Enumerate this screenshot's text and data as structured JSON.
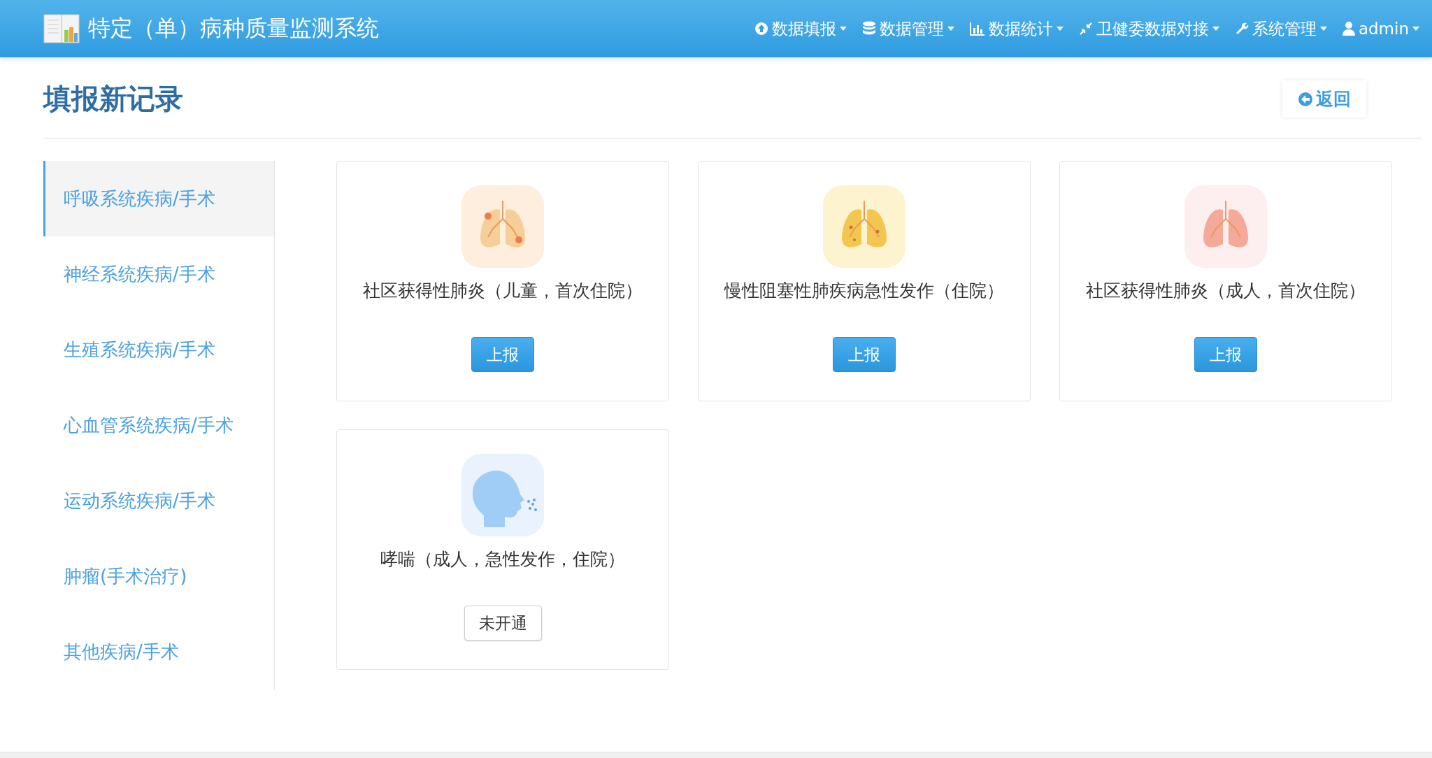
{
  "header": {
    "title": "特定（单）病种质量监测系统",
    "nav": [
      {
        "label": "数据填报",
        "kind": "upload"
      },
      {
        "label": "数据管理",
        "kind": "database"
      },
      {
        "label": "数据统计",
        "kind": "chart"
      },
      {
        "label": "卫健委数据对接",
        "kind": "compress"
      },
      {
        "label": "系统管理",
        "kind": "wrench"
      },
      {
        "label": "admin",
        "kind": "user"
      }
    ]
  },
  "page": {
    "title": "填报新记录",
    "back_button": "返回"
  },
  "sidebar": {
    "items": [
      {
        "label": "呼吸系统疾病/手术",
        "selected": true
      },
      {
        "label": "神经系统疾病/手术",
        "selected": false
      },
      {
        "label": "生殖系统疾病/手术",
        "selected": false
      },
      {
        "label": "心血管系统疾病/手术",
        "selected": false
      },
      {
        "label": "运动系统疾病/手术",
        "selected": false
      },
      {
        "label": "肿瘤(手术治疗)",
        "selected": false
      },
      {
        "label": "其他疾病/手术",
        "selected": false
      }
    ]
  },
  "cards": [
    {
      "kind": "lungs-spots",
      "title": "社区获得性肺炎（儿童，首次住院）",
      "button": "上报",
      "enabled": true
    },
    {
      "kind": "lungs-yellow",
      "title": "慢性阻塞性肺疾病急性发作（住院）",
      "button": "上报",
      "enabled": true
    },
    {
      "kind": "lungs-pink",
      "title": "社区获得性肺炎（成人，首次住院）",
      "button": "上报",
      "enabled": true
    },
    {
      "kind": "head",
      "title": "哮喘（成人，急性发作，住院）",
      "button": "未开通",
      "enabled": false
    }
  ]
}
